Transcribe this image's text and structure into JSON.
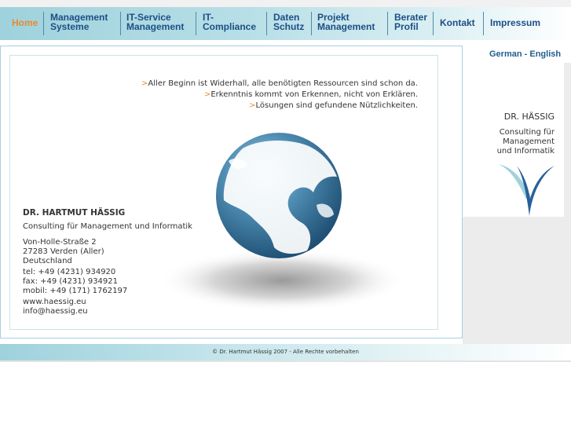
{
  "nav": {
    "items": [
      {
        "label": "Home"
      },
      {
        "label": "Management\nSysteme"
      },
      {
        "label": "IT-Service\nManagement"
      },
      {
        "label": "IT-\nCompliance"
      },
      {
        "label": "Daten\nSchutz"
      },
      {
        "label": "Projekt\nManagement"
      },
      {
        "label": "Berater\nProfil"
      },
      {
        "label": "Kontakt"
      },
      {
        "label": "Impressum"
      }
    ]
  },
  "lang": {
    "german": "German",
    "separator": " - ",
    "english": "English"
  },
  "quotes": {
    "mark": ">",
    "lines": [
      "Aller Beginn ist Widerhall, alle benötigten Ressourcen sind schon da.",
      "Erkenntnis kommt von Erkennen, nicht von Erklären.",
      "Lösungen sind gefundene Nützlichkeiten."
    ]
  },
  "address": {
    "name": "DR. HARTMUT HÄSSIG",
    "subtitle": "Consulting für Management und Informatik",
    "street": "Von-Holle-Straße 2",
    "city": "27283 Verden (Aller)",
    "country": "Deutschland",
    "tel": "tel:  +49 (4231) 934920",
    "fax": "fax: +49 (4231) 934921",
    "mobil": "mobil: +49 (171) 1762197",
    "web": "www.haessig.eu",
    "email": "info@haessig.eu"
  },
  "brand": {
    "name": "DR. HÄSSIG",
    "line1": "Consulting für",
    "line2": "Management",
    "line3": "und Informatik"
  },
  "footer": {
    "copyright": "© Dr. Hartmut Hässig 2007 - Alle Rechte vorbehalten"
  },
  "colors": {
    "accent": "#e88b2f",
    "nav_text": "#1c4f86",
    "globe": "#3d7fa5"
  }
}
